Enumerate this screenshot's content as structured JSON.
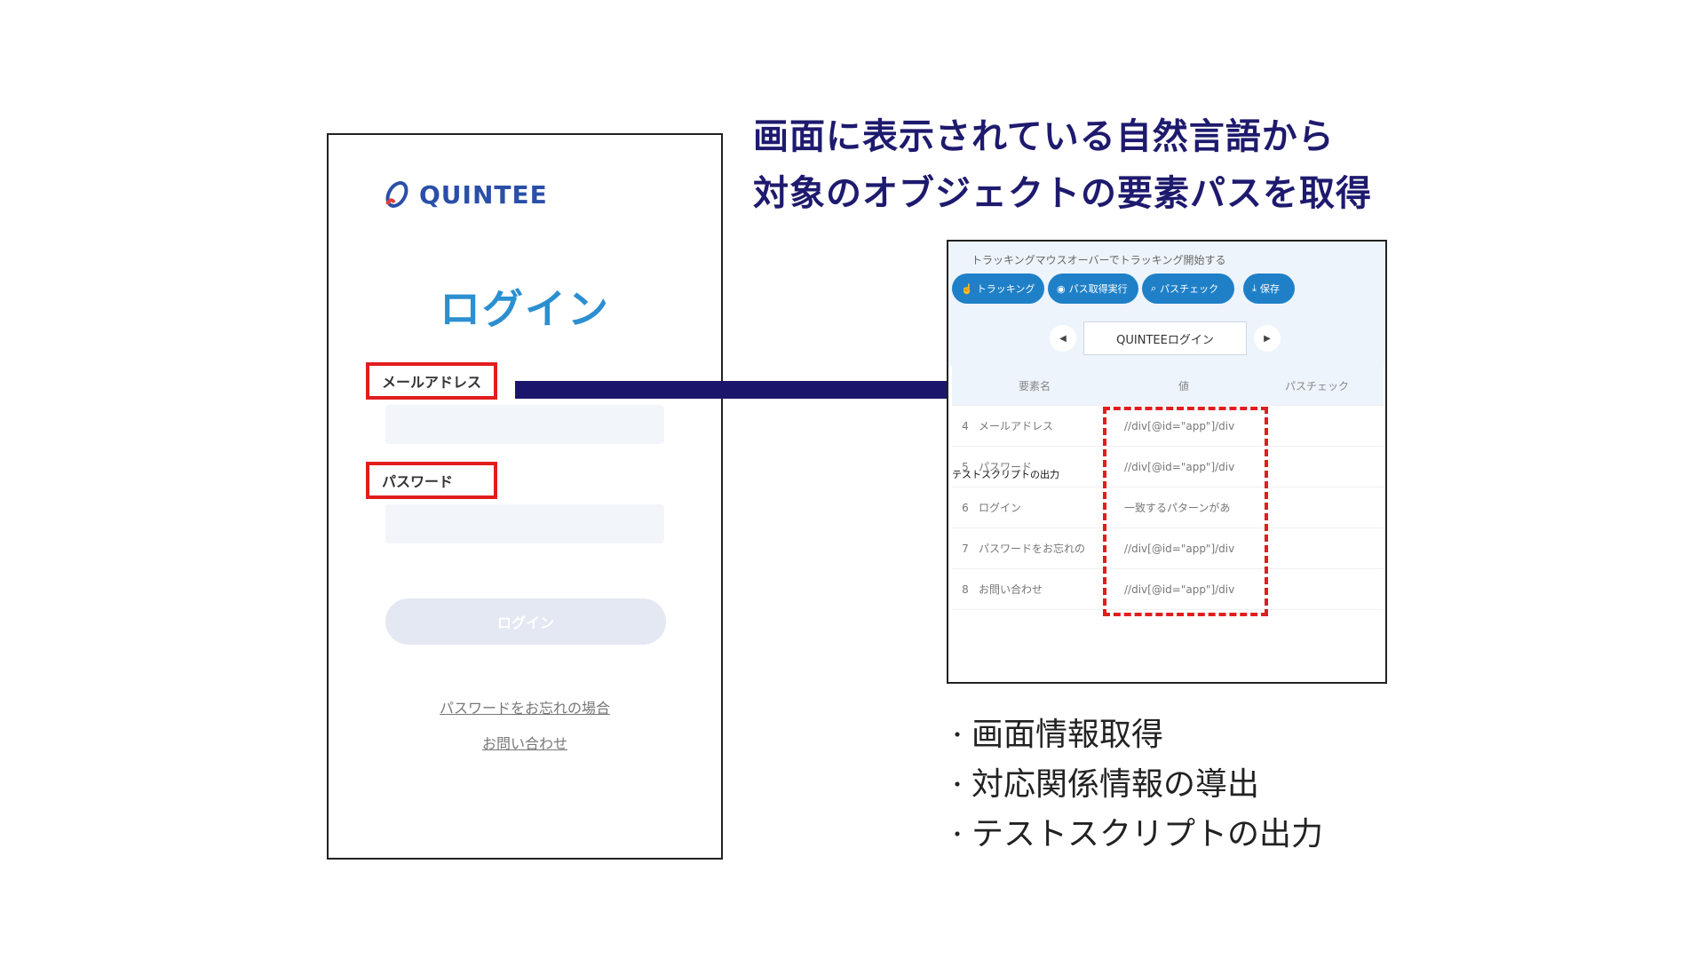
{
  "heading": {
    "line1": "画面に表示されている自然言語から",
    "line2": "対象のオブジェクトの要素パスを取得"
  },
  "login": {
    "logo_text": "QUINTEE",
    "title": "ログイン",
    "email_label": "メールアドレス",
    "password_label": "パスワード",
    "login_button": "ログイン",
    "forgot_link": "パスワードをお忘れの場合",
    "contact_link": "お問い合わせ"
  },
  "tool": {
    "hint": "トラッキングマウスオーバーでトラッキング開始する",
    "buttons": {
      "tracking": "トラッキング",
      "run": "パス取得実行",
      "check": "パスチェック",
      "save": "保存"
    },
    "page_title": "QUINTEEログイン",
    "columns": {
      "name": "要素名",
      "value": "値",
      "check": "パスチェック"
    },
    "rows": [
      {
        "num": "4",
        "name": "メールアドレス",
        "value": "//div[@id=\"app\"]/div"
      },
      {
        "num": "5",
        "name": "パスワード",
        "value": "//div[@id=\"app\"]/div"
      },
      {
        "num": "6",
        "name": "ログイン",
        "value": "一致するパターンがあ"
      },
      {
        "num": "7",
        "name": "パスワードをお忘れの",
        "value": "//div[@id=\"app\"]/div"
      },
      {
        "num": "8",
        "name": "お問い合わせ",
        "value": "//div[@id=\"app\"]/div"
      }
    ],
    "overlay_label": "テストスクリプトの出力"
  },
  "bullets": {
    "dot": "・",
    "items": [
      "画面情報取得",
      "対応関係情報の導出",
      "テストスクリプトの出力"
    ]
  },
  "colors": {
    "heading": "#1e1a6e",
    "arrow": "#1b166b",
    "highlight": "#e11d1d",
    "button_blue": "#1f80c8",
    "login_title": "#2b8fd0"
  }
}
